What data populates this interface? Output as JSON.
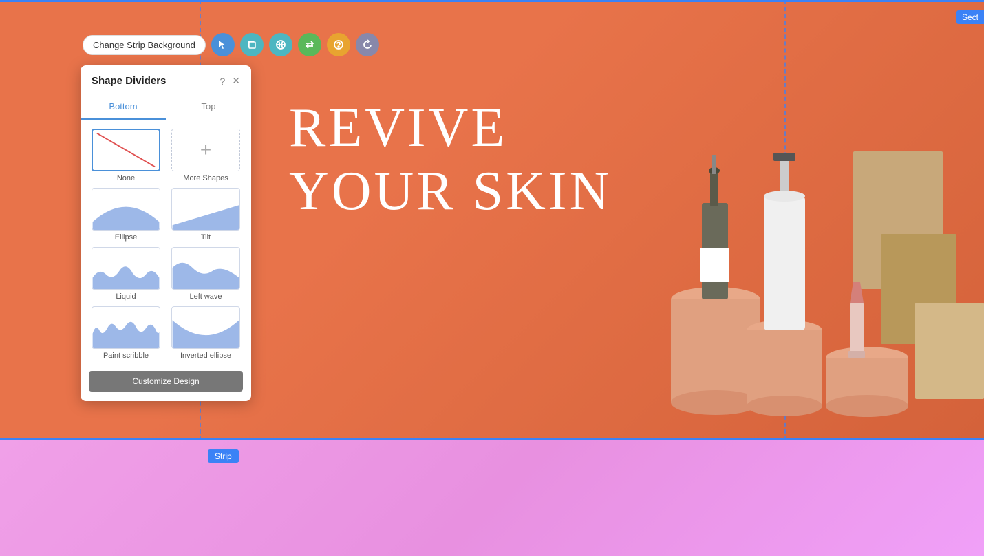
{
  "toolbar": {
    "change_bg_label": "Change Strip Background",
    "icons": [
      {
        "name": "pointer-icon",
        "symbol": "↖",
        "color": "blue"
      },
      {
        "name": "copy-icon",
        "symbol": "⧉",
        "color": "teal"
      },
      {
        "name": "link-icon",
        "symbol": "⊕",
        "color": "teal"
      },
      {
        "name": "swap-icon",
        "symbol": "⇄",
        "color": "green"
      },
      {
        "name": "help-icon",
        "symbol": "?",
        "color": "orange"
      },
      {
        "name": "refresh-icon",
        "symbol": "↻",
        "color": "gray"
      }
    ]
  },
  "panel": {
    "title": "Shape Dividers",
    "tabs": [
      {
        "label": "Bottom",
        "active": true
      },
      {
        "label": "Top",
        "active": false
      }
    ],
    "shapes": [
      {
        "id": "none",
        "label": "None",
        "selected": true
      },
      {
        "id": "more",
        "label": "More Shapes",
        "selected": false
      },
      {
        "id": "ellipse",
        "label": "Ellipse",
        "selected": false
      },
      {
        "id": "tilt",
        "label": "Tilt",
        "selected": false
      },
      {
        "id": "liquid",
        "label": "Liquid",
        "selected": false
      },
      {
        "id": "left-wave",
        "label": "Left wave",
        "selected": false
      },
      {
        "id": "paint-scribble",
        "label": "Paint scribble",
        "selected": false
      },
      {
        "id": "inverted-ellipse",
        "label": "Inverted ellipse",
        "selected": false
      }
    ],
    "customize_btn_label": "Customize Design"
  },
  "hero": {
    "line1": "REVIVE",
    "line2": "YOUR SKIN"
  },
  "labels": {
    "strip": "Strip",
    "sect": "Sect"
  },
  "colors": {
    "hero_bg": "#e8734a",
    "pink_section": "#f0a0f0",
    "accent_blue": "#3b82f6",
    "panel_selected_border": "#4a90d9"
  }
}
